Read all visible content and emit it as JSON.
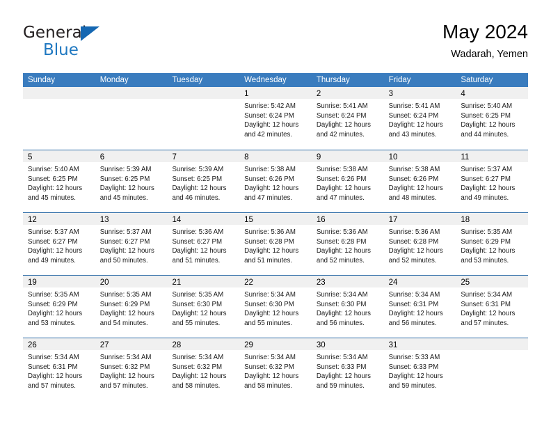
{
  "brand": {
    "name_top": "General",
    "name_bottom": "Blue",
    "triangle_color": "#1567b2",
    "blue_color": "#1f78c1"
  },
  "header": {
    "title": "May 2024",
    "subtitle": "Wadarah, Yemen"
  },
  "theme": {
    "header_row_bg": "#3a7cbe",
    "week_separator": "#2e6da8",
    "day_band_bg": "#f0f0f0",
    "text": "#000000"
  },
  "columns": [
    "Sunday",
    "Monday",
    "Tuesday",
    "Wednesday",
    "Thursday",
    "Friday",
    "Saturday"
  ],
  "weeks": [
    [
      {
        "day": "",
        "lines": []
      },
      {
        "day": "",
        "lines": []
      },
      {
        "day": "",
        "lines": []
      },
      {
        "day": "1",
        "lines": [
          "Sunrise: 5:42 AM",
          "Sunset: 6:24 PM",
          "Daylight: 12 hours",
          "and 42 minutes."
        ]
      },
      {
        "day": "2",
        "lines": [
          "Sunrise: 5:41 AM",
          "Sunset: 6:24 PM",
          "Daylight: 12 hours",
          "and 42 minutes."
        ]
      },
      {
        "day": "3",
        "lines": [
          "Sunrise: 5:41 AM",
          "Sunset: 6:24 PM",
          "Daylight: 12 hours",
          "and 43 minutes."
        ]
      },
      {
        "day": "4",
        "lines": [
          "Sunrise: 5:40 AM",
          "Sunset: 6:25 PM",
          "Daylight: 12 hours",
          "and 44 minutes."
        ]
      }
    ],
    [
      {
        "day": "5",
        "lines": [
          "Sunrise: 5:40 AM",
          "Sunset: 6:25 PM",
          "Daylight: 12 hours",
          "and 45 minutes."
        ]
      },
      {
        "day": "6",
        "lines": [
          "Sunrise: 5:39 AM",
          "Sunset: 6:25 PM",
          "Daylight: 12 hours",
          "and 45 minutes."
        ]
      },
      {
        "day": "7",
        "lines": [
          "Sunrise: 5:39 AM",
          "Sunset: 6:25 PM",
          "Daylight: 12 hours",
          "and 46 minutes."
        ]
      },
      {
        "day": "8",
        "lines": [
          "Sunrise: 5:38 AM",
          "Sunset: 6:26 PM",
          "Daylight: 12 hours",
          "and 47 minutes."
        ]
      },
      {
        "day": "9",
        "lines": [
          "Sunrise: 5:38 AM",
          "Sunset: 6:26 PM",
          "Daylight: 12 hours",
          "and 47 minutes."
        ]
      },
      {
        "day": "10",
        "lines": [
          "Sunrise: 5:38 AM",
          "Sunset: 6:26 PM",
          "Daylight: 12 hours",
          "and 48 minutes."
        ]
      },
      {
        "day": "11",
        "lines": [
          "Sunrise: 5:37 AM",
          "Sunset: 6:27 PM",
          "Daylight: 12 hours",
          "and 49 minutes."
        ]
      }
    ],
    [
      {
        "day": "12",
        "lines": [
          "Sunrise: 5:37 AM",
          "Sunset: 6:27 PM",
          "Daylight: 12 hours",
          "and 49 minutes."
        ]
      },
      {
        "day": "13",
        "lines": [
          "Sunrise: 5:37 AM",
          "Sunset: 6:27 PM",
          "Daylight: 12 hours",
          "and 50 minutes."
        ]
      },
      {
        "day": "14",
        "lines": [
          "Sunrise: 5:36 AM",
          "Sunset: 6:27 PM",
          "Daylight: 12 hours",
          "and 51 minutes."
        ]
      },
      {
        "day": "15",
        "lines": [
          "Sunrise: 5:36 AM",
          "Sunset: 6:28 PM",
          "Daylight: 12 hours",
          "and 51 minutes."
        ]
      },
      {
        "day": "16",
        "lines": [
          "Sunrise: 5:36 AM",
          "Sunset: 6:28 PM",
          "Daylight: 12 hours",
          "and 52 minutes."
        ]
      },
      {
        "day": "17",
        "lines": [
          "Sunrise: 5:36 AM",
          "Sunset: 6:28 PM",
          "Daylight: 12 hours",
          "and 52 minutes."
        ]
      },
      {
        "day": "18",
        "lines": [
          "Sunrise: 5:35 AM",
          "Sunset: 6:29 PM",
          "Daylight: 12 hours",
          "and 53 minutes."
        ]
      }
    ],
    [
      {
        "day": "19",
        "lines": [
          "Sunrise: 5:35 AM",
          "Sunset: 6:29 PM",
          "Daylight: 12 hours",
          "and 53 minutes."
        ]
      },
      {
        "day": "20",
        "lines": [
          "Sunrise: 5:35 AM",
          "Sunset: 6:29 PM",
          "Daylight: 12 hours",
          "and 54 minutes."
        ]
      },
      {
        "day": "21",
        "lines": [
          "Sunrise: 5:35 AM",
          "Sunset: 6:30 PM",
          "Daylight: 12 hours",
          "and 55 minutes."
        ]
      },
      {
        "day": "22",
        "lines": [
          "Sunrise: 5:34 AM",
          "Sunset: 6:30 PM",
          "Daylight: 12 hours",
          "and 55 minutes."
        ]
      },
      {
        "day": "23",
        "lines": [
          "Sunrise: 5:34 AM",
          "Sunset: 6:30 PM",
          "Daylight: 12 hours",
          "and 56 minutes."
        ]
      },
      {
        "day": "24",
        "lines": [
          "Sunrise: 5:34 AM",
          "Sunset: 6:31 PM",
          "Daylight: 12 hours",
          "and 56 minutes."
        ]
      },
      {
        "day": "25",
        "lines": [
          "Sunrise: 5:34 AM",
          "Sunset: 6:31 PM",
          "Daylight: 12 hours",
          "and 57 minutes."
        ]
      }
    ],
    [
      {
        "day": "26",
        "lines": [
          "Sunrise: 5:34 AM",
          "Sunset: 6:31 PM",
          "Daylight: 12 hours",
          "and 57 minutes."
        ]
      },
      {
        "day": "27",
        "lines": [
          "Sunrise: 5:34 AM",
          "Sunset: 6:32 PM",
          "Daylight: 12 hours",
          "and 57 minutes."
        ]
      },
      {
        "day": "28",
        "lines": [
          "Sunrise: 5:34 AM",
          "Sunset: 6:32 PM",
          "Daylight: 12 hours",
          "and 58 minutes."
        ]
      },
      {
        "day": "29",
        "lines": [
          "Sunrise: 5:34 AM",
          "Sunset: 6:32 PM",
          "Daylight: 12 hours",
          "and 58 minutes."
        ]
      },
      {
        "day": "30",
        "lines": [
          "Sunrise: 5:34 AM",
          "Sunset: 6:33 PM",
          "Daylight: 12 hours",
          "and 59 minutes."
        ]
      },
      {
        "day": "31",
        "lines": [
          "Sunrise: 5:33 AM",
          "Sunset: 6:33 PM",
          "Daylight: 12 hours",
          "and 59 minutes."
        ]
      },
      {
        "day": "",
        "lines": []
      }
    ]
  ]
}
